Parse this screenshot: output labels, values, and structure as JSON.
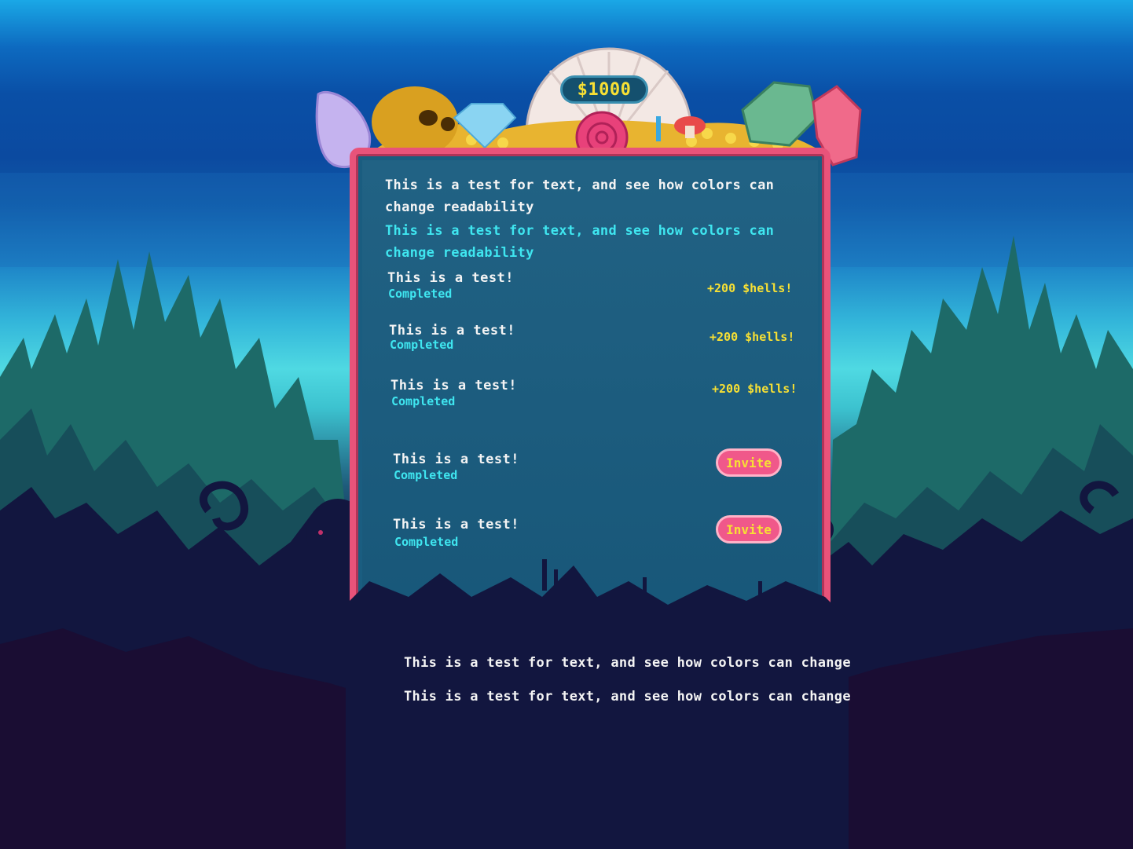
{
  "hud": {
    "money": "$1000"
  },
  "panel": {
    "paragraph_white": "This is a test for text, and see how colors can change readability",
    "paragraph_cyan": "This is a test for text, and see how colors can change readability",
    "tasks": [
      {
        "title": "This is a test!",
        "status": "Completed",
        "reward": "+200 $hells!"
      },
      {
        "title": "This is a test!",
        "status": "Completed",
        "reward": "+200 $hells!"
      },
      {
        "title": "This is a test!",
        "status": "Completed",
        "reward": "+200 $hells!"
      },
      {
        "title": "This is a test!",
        "status": "Completed",
        "button": "Invite"
      },
      {
        "title": "This is a test!",
        "status": "Completed",
        "button": "Invite"
      }
    ]
  },
  "footer": {
    "line1": "This is a test for text, and see how colors can change",
    "line2": "This is a test for text, and see how colors can change"
  },
  "colors": {
    "panel_border": "#e8537a",
    "panel_fill": "#1a5d80",
    "text_white": "#f4f4f4",
    "text_cyan": "#3fe6f0",
    "text_yellow": "#f7e034",
    "button_fill": "#f0588a"
  }
}
